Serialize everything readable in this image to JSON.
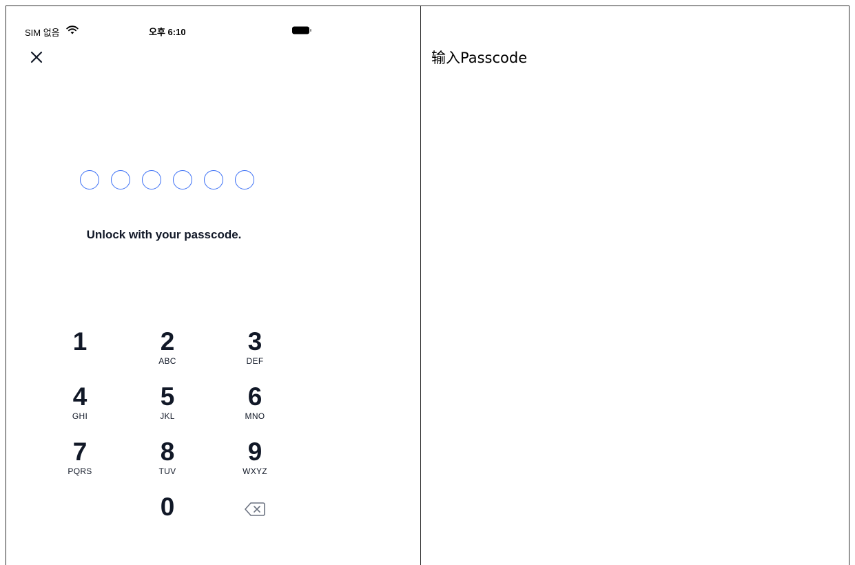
{
  "status_bar": {
    "carrier": "SIM 없음",
    "time": "오후 6:10",
    "icons": [
      "wifi-icon",
      "battery-icon"
    ]
  },
  "header": {
    "close_icon": "close-icon"
  },
  "passcode": {
    "dot_count": 6,
    "filled": 0,
    "prompt": "Unlock with your passcode."
  },
  "keypad": {
    "keys": [
      {
        "digit": "1",
        "letters": ""
      },
      {
        "digit": "2",
        "letters": "ABC"
      },
      {
        "digit": "3",
        "letters": "DEF"
      },
      {
        "digit": "4",
        "letters": "GHI"
      },
      {
        "digit": "5",
        "letters": "JKL"
      },
      {
        "digit": "6",
        "letters": "MNO"
      },
      {
        "digit": "7",
        "letters": "PQRS"
      },
      {
        "digit": "8",
        "letters": "TUV"
      },
      {
        "digit": "9",
        "letters": "WXYZ"
      },
      {
        "digit": "0",
        "letters": ""
      }
    ],
    "delete_icon": "delete-icon"
  },
  "side_panel": {
    "title": "输入Passcode"
  },
  "colors": {
    "accent": "#3b6ff5",
    "text": "#111827"
  }
}
